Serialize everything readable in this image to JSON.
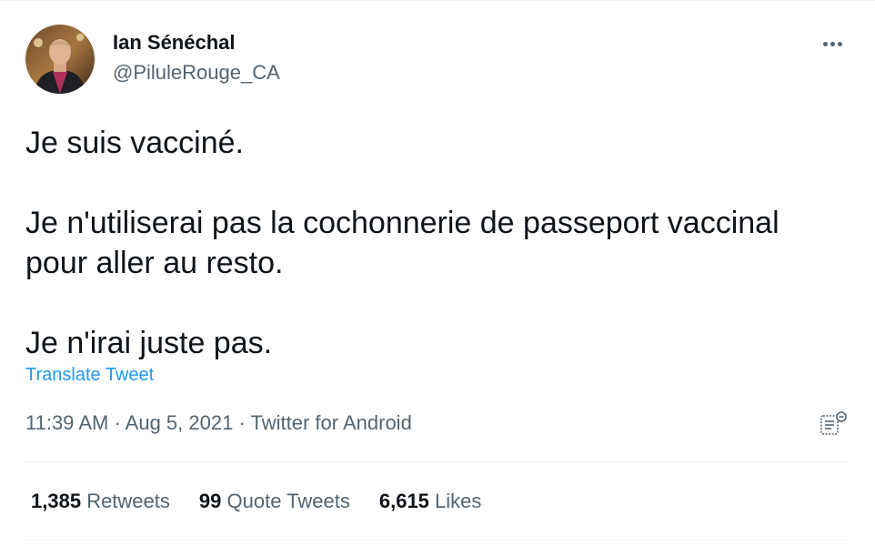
{
  "author": {
    "name": "Ian Sénéchal",
    "handle": "@PiluleRouge_CA"
  },
  "tweet": {
    "text": "Je suis vacciné.\n\nJe n'utiliserai pas la cochonnerie de passeport vaccinal\npour aller au resto.\n\nJe n'irai juste pas.",
    "translate_label": "Translate Tweet"
  },
  "meta": {
    "time": "11:39 AM",
    "separator": " · ",
    "date": "Aug 5, 2021",
    "source": "Twitter for Android"
  },
  "stats": {
    "retweets_count": "1,385",
    "retweets_label": "Retweets",
    "quotes_count": "99",
    "quotes_label": "Quote Tweets",
    "likes_count": "6,615",
    "likes_label": "Likes"
  },
  "icons": {
    "more": "more-horizontal-icon",
    "analytics": "analytics-icon"
  },
  "colors": {
    "text_primary": "#0f1419",
    "text_secondary": "#536471",
    "link": "#1d9bf0",
    "divider": "#eff3f4"
  }
}
